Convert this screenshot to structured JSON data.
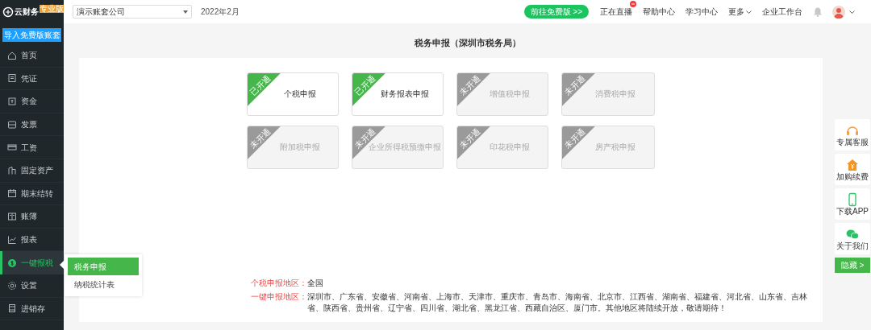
{
  "logo": {
    "text": "云财务",
    "badge": "专业版"
  },
  "company_select": {
    "value": "演示账套公司"
  },
  "period": "2022年2月",
  "upgrade_button": "前往免费版 >>",
  "top_links": [
    {
      "label": "正在直播",
      "kind": "live"
    },
    {
      "label": "帮助中心",
      "kind": "link"
    },
    {
      "label": "学习中心",
      "kind": "link"
    },
    {
      "label": "更多",
      "kind": "dropdown"
    },
    {
      "label": "企业工作台",
      "kind": "link"
    }
  ],
  "sidebar": {
    "import_button": "导入免费版账套",
    "items": [
      {
        "label": "首页",
        "selected": false
      },
      {
        "label": "凭证",
        "selected": false
      },
      {
        "label": "资金",
        "selected": false
      },
      {
        "label": "发票",
        "selected": false
      },
      {
        "label": "工资",
        "selected": false
      },
      {
        "label": "固定资产",
        "selected": false
      },
      {
        "label": "期末结转",
        "selected": false
      },
      {
        "label": "账簿",
        "selected": false
      },
      {
        "label": "报表",
        "selected": false
      },
      {
        "label": "一键报税",
        "selected": true
      },
      {
        "label": "设置",
        "selected": false
      },
      {
        "label": "进销存",
        "selected": false
      }
    ]
  },
  "submenu": [
    {
      "label": "税务申报",
      "selected": true
    },
    {
      "label": "纳税统计表",
      "selected": false
    }
  ],
  "page_title": "税务申报（深圳市税务局）",
  "services": [
    {
      "name": "个税申报",
      "ribbon": "已开通",
      "enabled": true
    },
    {
      "name": "财务报表申报",
      "ribbon": "已开通",
      "enabled": true
    },
    {
      "name": "增值税申报",
      "ribbon": "未开通",
      "enabled": false
    },
    {
      "name": "消费税申报",
      "ribbon": "未开通",
      "enabled": false
    },
    {
      "name": "附加税申报",
      "ribbon": "未开通",
      "enabled": false
    },
    {
      "name": "企业所得税预缴申报",
      "ribbon": "未开通",
      "enabled": false
    },
    {
      "name": "印花税申报",
      "ribbon": "未开通",
      "enabled": false
    },
    {
      "name": "房产税申报",
      "ribbon": "未开通",
      "enabled": false
    }
  ],
  "regions": [
    {
      "label": "个税申报地区：",
      "text": "全国"
    },
    {
      "label": "一键申报地区：",
      "text": "深圳市、广东省、安徽省、河南省、上海市、天津市、重庆市、青岛市、海南省、北京市、江西省、湖南省、福建省、河北省、山东省、吉林省、陕西省、贵州省、辽宁省、四川省、湖北省、黑龙江省、西藏自治区、厦门市。其他地区将陆续开放，敬请期待！"
    }
  ],
  "side_widgets": [
    {
      "label": "专属客服"
    },
    {
      "label": "加购续费"
    },
    {
      "label": "下载APP"
    },
    {
      "label": "关于我们"
    }
  ],
  "hide_button": "隐藏 >"
}
